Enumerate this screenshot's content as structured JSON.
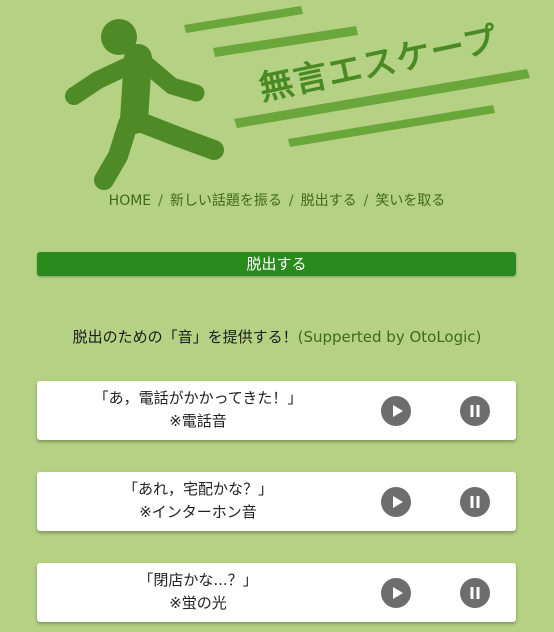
{
  "header": {
    "logo_title": "無言エスケープ"
  },
  "nav": {
    "items": [
      {
        "label": "HOME"
      },
      {
        "label": "新しい話題を振る"
      },
      {
        "label": "脱出する"
      },
      {
        "label": "笑いを取る"
      }
    ],
    "separator": "/"
  },
  "section": {
    "title": "脱出する"
  },
  "intro": {
    "text": "脱出のための「音」を提供する！",
    "credit": "(Supperted by OtoLogic)"
  },
  "sounds": [
    {
      "line1": "「あ，電話がかかってきた！」",
      "line2": "※電話音"
    },
    {
      "line1": "「あれ，宅配かな？」",
      "line2": "※インターホン音"
    },
    {
      "line1": "「閉店かな...？」",
      "line2": "※蛍の光"
    }
  ],
  "icons": {
    "play": "play-icon",
    "pause": "pause-icon"
  },
  "colors": {
    "background": "#b5d183",
    "accent_green": "#2a8a1d",
    "logo_green": "#4a8a24",
    "button_gray": "#6d6d6d"
  }
}
